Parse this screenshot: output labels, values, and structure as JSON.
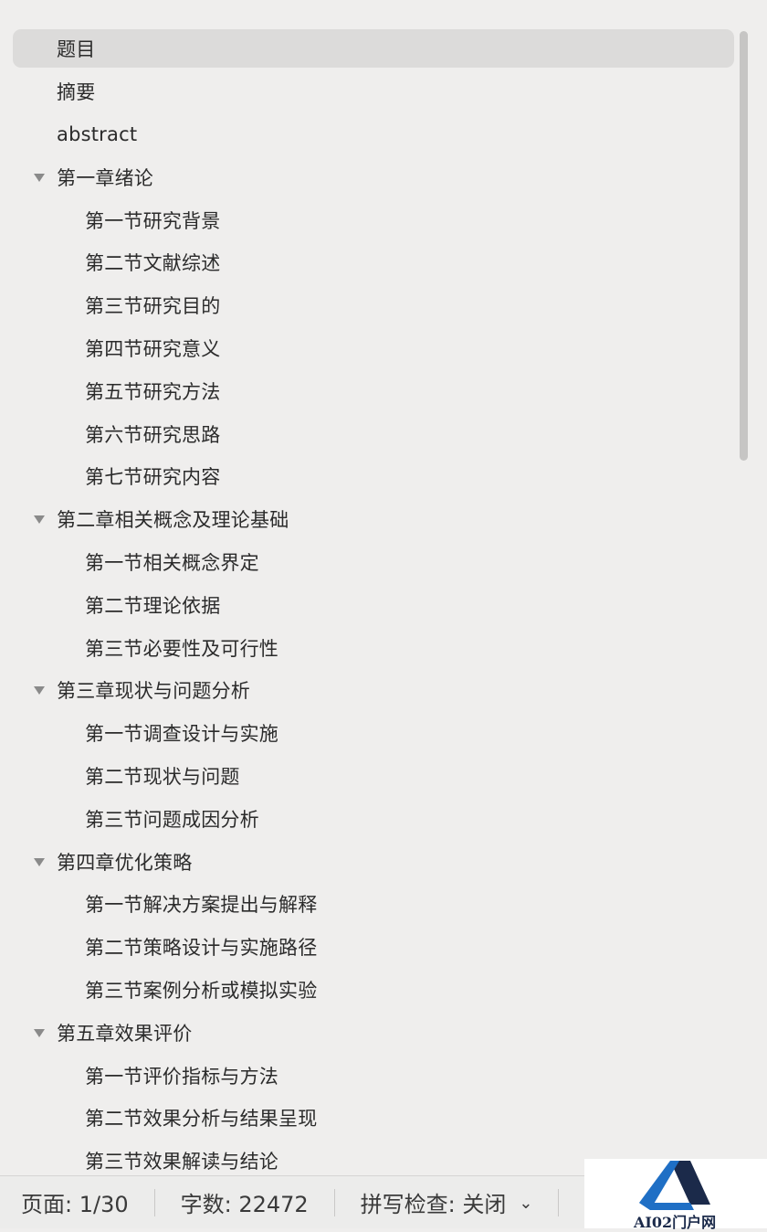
{
  "outline": {
    "items": [
      {
        "label": "题目",
        "level": 1,
        "expandable": false,
        "selected": true
      },
      {
        "label": "摘要",
        "level": 1,
        "expandable": false
      },
      {
        "label": "abstract",
        "level": 1,
        "expandable": false
      },
      {
        "label": "第一章绪论",
        "level": 1,
        "expandable": true
      },
      {
        "label": "第一节研究背景",
        "level": 2
      },
      {
        "label": "第二节文献综述",
        "level": 2
      },
      {
        "label": "第三节研究目的",
        "level": 2
      },
      {
        "label": "第四节研究意义",
        "level": 2
      },
      {
        "label": "第五节研究方法",
        "level": 2
      },
      {
        "label": "第六节研究思路",
        "level": 2
      },
      {
        "label": "第七节研究内容",
        "level": 2
      },
      {
        "label": "第二章相关概念及理论基础",
        "level": 1,
        "expandable": true
      },
      {
        "label": "第一节相关概念界定",
        "level": 2
      },
      {
        "label": "第二节理论依据",
        "level": 2
      },
      {
        "label": "第三节必要性及可行性",
        "level": 2
      },
      {
        "label": "第三章现状与问题分析",
        "level": 1,
        "expandable": true
      },
      {
        "label": "第一节调查设计与实施",
        "level": 2
      },
      {
        "label": "第二节现状与问题",
        "level": 2
      },
      {
        "label": "第三节问题成因分析",
        "level": 2
      },
      {
        "label": "第四章优化策略",
        "level": 1,
        "expandable": true
      },
      {
        "label": "第一节解决方案提出与解释",
        "level": 2
      },
      {
        "label": "第二节策略设计与实施路径",
        "level": 2
      },
      {
        "label": "第三节案例分析或模拟实验",
        "level": 2
      },
      {
        "label": "第五章效果评价",
        "level": 1,
        "expandable": true
      },
      {
        "label": "第一节评价指标与方法",
        "level": 2
      },
      {
        "label": "第二节效果分析与结果呈现",
        "level": 2
      },
      {
        "label": "第三节效果解读与结论",
        "level": 2
      }
    ]
  },
  "status_bar": {
    "page": "页面: 1/30",
    "word_count": "字数: 22472",
    "spell_check": "拼写检查: 关闭"
  },
  "watermark": {
    "text": "AI02门户网"
  },
  "colors": {
    "panel_bg": "#efeeed",
    "selected_bg": "#dcdbda",
    "text": "#2b2b2b",
    "disclosure": "#8a8a8a",
    "logo_blue": "#1f6fc5",
    "logo_navy": "#1b2a4a"
  }
}
